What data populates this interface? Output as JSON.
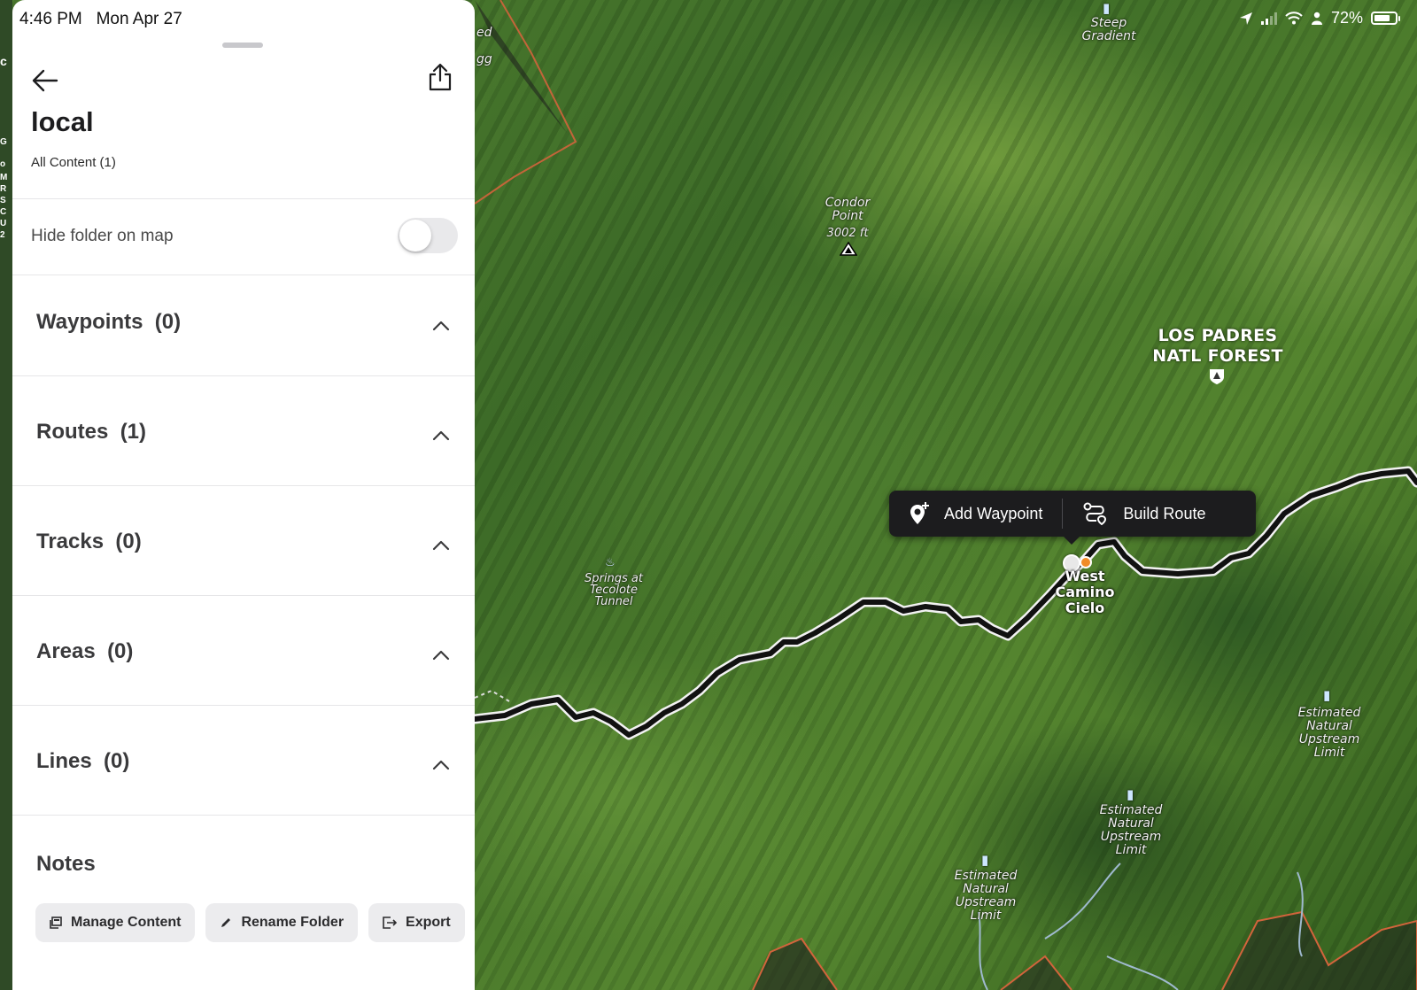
{
  "status_bar": {
    "time": "4:46 PM",
    "date": "Mon Apr 27",
    "battery": "72%"
  },
  "panel": {
    "title": "local",
    "subtitle": "All Content (1)",
    "hide_toggle": {
      "label": "Hide folder on map",
      "enabled": false
    },
    "sections": [
      {
        "label": "Waypoints",
        "count": "(0)"
      },
      {
        "label": "Routes",
        "count": "(1)"
      },
      {
        "label": "Tracks",
        "count": "(0)"
      },
      {
        "label": "Areas",
        "count": "(0)"
      },
      {
        "label": "Lines",
        "count": "(0)"
      }
    ],
    "notes_label": "Notes",
    "actions": {
      "manage": "Manage Content",
      "rename": "Rename Folder",
      "export": "Export"
    }
  },
  "map": {
    "popup": {
      "add_waypoint": "Add Waypoint",
      "build_route": "Build Route"
    },
    "labels": {
      "steep": "Steep Gradient",
      "condor": "Condor Point",
      "condor_elev": "3002 ft",
      "forest": "LOS PADRES NATL FOREST",
      "springs": "Springs at Tecolote Tunnel",
      "west_camino": "West Camino Cielo",
      "est1": "Estimated Natural Upstream Limit",
      "est2": "Estimated Natural Upstream Limit",
      "est3": "Estimated Natural Upstream Limit",
      "edge_ed": "ed",
      "edge_gg": "gg"
    }
  },
  "colors": {
    "accent_route": "#111111",
    "panel_bg": "#ffffff",
    "popup_bg": "#1c1c1e"
  }
}
